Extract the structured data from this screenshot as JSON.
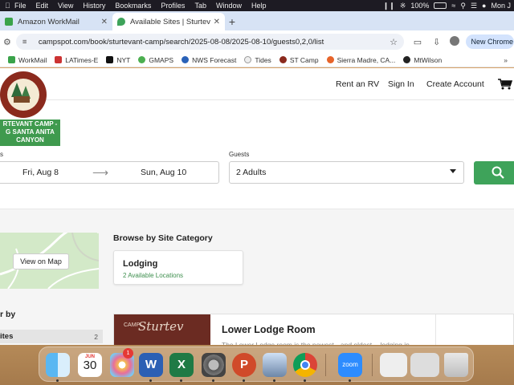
{
  "menubar": {
    "items": [
      "File",
      "Edit",
      "View",
      "History",
      "Bookmarks",
      "Profiles",
      "Tab",
      "Window",
      "Help"
    ],
    "battery_pct": "100%",
    "clock": "Mon J"
  },
  "tabs": [
    {
      "title": "Amazon WorkMail",
      "active": false
    },
    {
      "title": "Available Sites | Sturtevant Ca",
      "active": true
    }
  ],
  "address": {
    "url": "campspot.com/book/sturtevant-camp/search/2025-08-08/2025-08-10/guests0,2,0/list"
  },
  "toolbar": {
    "new_chrome_label": "New Chrome"
  },
  "bookmarks": [
    "WorkMail",
    "LATimes-E",
    "NYT",
    "GMAPS",
    "NWS Forecast",
    "Tides",
    "ST Camp",
    "Sierra Madre, CA...",
    "MtWilson"
  ],
  "site": {
    "logo_text": "RTEVANT CAMP - G SANTA ANITA CANYON",
    "nav": {
      "rent_rv": "Rent an RV",
      "sign_in": "Sign In",
      "create_account": "Create Account"
    }
  },
  "search": {
    "dates_label": "s",
    "check_in": "Fri, Aug 8",
    "check_out": "Sun, Aug 10",
    "guests_label": "Guests",
    "guests_value": "2 Adults"
  },
  "browse": {
    "view_on_map": "View on Map",
    "section_title": "Browse by Site Category",
    "category_name": "Lodging",
    "category_count": "2 Available Locations",
    "filter_heading": "r by",
    "filter_row_label": "ites",
    "filter_row_count": "2"
  },
  "result": {
    "title": "Lower Lodge Room",
    "desc": "The Lower Lodge room is the newest-- and oldest -- lodging in"
  },
  "dock": {
    "calendar_month": "JUN",
    "calendar_day": "30",
    "badge_count": "1",
    "zoom_label": "zoom"
  },
  "colors": {
    "accent_green": "#3ea35a",
    "tab_strip": "#d7e3f5",
    "logo_red": "#8b2a1d"
  }
}
